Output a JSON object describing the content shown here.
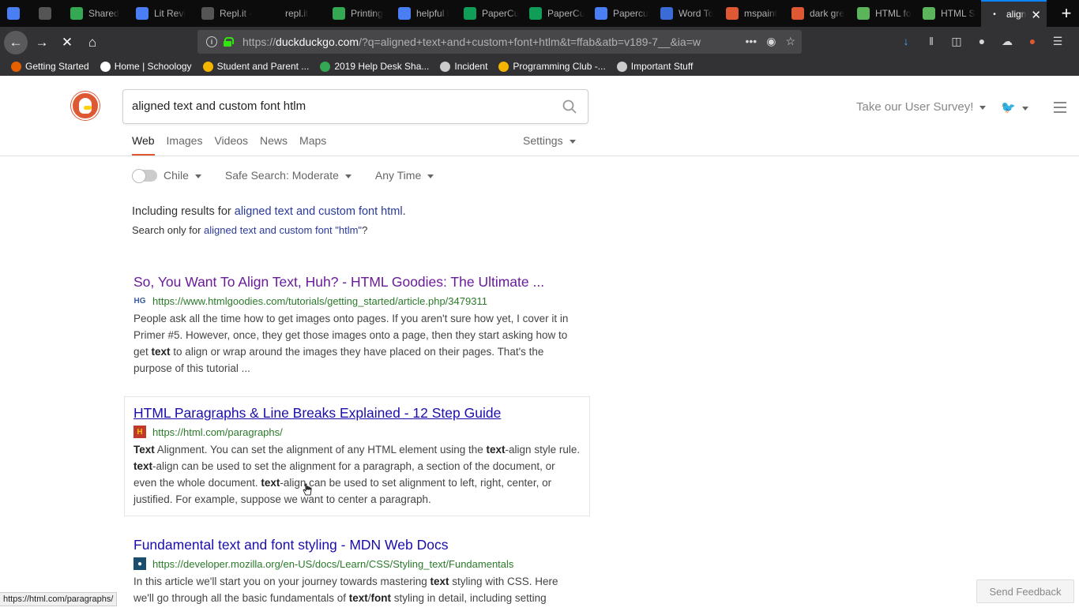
{
  "tabs": [
    {
      "title": "",
      "color": "#4a7ef5",
      "icon": "docs-icon"
    },
    {
      "title": "",
      "color": "#555",
      "icon": "replit-icon"
    },
    {
      "title": "Shared",
      "color": "#34a853",
      "icon": "drive-icon"
    },
    {
      "title": "Lit Revi",
      "color": "#4a7ef5",
      "icon": "docs-icon"
    },
    {
      "title": "Repl.it -",
      "color": "#555",
      "icon": "replit-icon"
    },
    {
      "title": "repl.it",
      "color": "transparent",
      "icon": "none"
    },
    {
      "title": "Printing",
      "color": "#34a853",
      "icon": "drive-icon"
    },
    {
      "title": "helpful l",
      "color": "#4a7ef5",
      "icon": "docs-icon"
    },
    {
      "title": "PaperCu",
      "color": "#0f9d58",
      "icon": "sheets-icon"
    },
    {
      "title": "PaperCu",
      "color": "#0f9d58",
      "icon": "classroom-icon"
    },
    {
      "title": "Papercu",
      "color": "#4a7ef5",
      "icon": "docs-icon"
    },
    {
      "title": "Word To",
      "color": "#3b6bd6",
      "icon": "converter-icon"
    },
    {
      "title": "mspaint",
      "color": "#de5833",
      "icon": "duckduckgo-icon"
    },
    {
      "title": "dark gre",
      "color": "#de5833",
      "icon": "duckduckgo-icon"
    },
    {
      "title": "HTML fo",
      "color": "#5bb55b",
      "icon": "chart-icon"
    },
    {
      "title": "HTML S",
      "color": "#5bb55b",
      "icon": "chart-icon"
    },
    {
      "title": "align",
      "color": "transparent",
      "icon": "loading-icon",
      "active": true
    }
  ],
  "url": {
    "prefix": "https://",
    "host": "duckduckgo.com",
    "path": "/?q=aligned+text+and+custom+font+htlm&t=ffab&atb=v189-7__&ia=w"
  },
  "bookmarks": [
    {
      "label": "Getting Started",
      "color": "#e66000"
    },
    {
      "label": "Home | Schoology",
      "color": "#ffffff"
    },
    {
      "label": "Student and Parent ...",
      "color": "#f5b400"
    },
    {
      "label": "2019 Help Desk Sha...",
      "color": "#34a853"
    },
    {
      "label": "Incident",
      "color": "#cccccc"
    },
    {
      "label": "Programming Club -...",
      "color": "#f5b400"
    },
    {
      "label": "Important Stuff",
      "color": "#cccccc"
    }
  ],
  "search": {
    "query": "aligned text and custom font htlm"
  },
  "header": {
    "survey": "Take our User Survey!"
  },
  "nav": {
    "web": "Web",
    "images": "Images",
    "videos": "Videos",
    "news": "News",
    "maps": "Maps",
    "settings": "Settings"
  },
  "filters": {
    "region": "Chile",
    "safe": "Safe Search: Moderate",
    "time": "Any Time"
  },
  "spelling": {
    "including_prefix": "Including results for ",
    "including_link": "aligned text and custom font html",
    "including_suffix": ".",
    "only_prefix": "Search only for ",
    "only_link": "aligned text and custom font \"htlm\"",
    "only_suffix": "?"
  },
  "results": [
    {
      "title": "So, You Want To Align Text, Huh? - HTML Goodies: The Ultimate ...",
      "url": "https://www.htmlgoodies.com/tutorials/getting_started/article.php/3479311",
      "favicon": "HG",
      "snippet_html": "People ask all the time how to get images onto pages. If you aren't sure how yet, I cover it in Primer #5. However, once, they get those images onto a page, then they start asking how to get <b>text</b> to align or wrap around the images they have placed on their pages. That's the purpose of this tutorial ..."
    },
    {
      "title": "HTML Paragraphs & Line Breaks Explained - 12 Step Guide",
      "url": "https://html.com/paragraphs/",
      "favicon": "H",
      "snippet_html": "<b>Text</b> Alignment. You can set the alignment of any HTML element using the <b>text</b>-align style rule. <b>text</b>-align can be used to set the alignment for a paragraph, a section of the document, or even the whole document. <b>text</b>-align can be used to set alignment to left, right, center, or justified. For example, suppose we want to center a paragraph."
    },
    {
      "title": "Fundamental text and font styling - MDN Web Docs",
      "url": "https://developer.mozilla.org/en-US/docs/Learn/CSS/Styling_text/Fundamentals",
      "favicon": "",
      "snippet_html": "In this article we'll start you on your journey towards mastering <b>text</b> styling with CSS. Here we'll go through all the basic fundamentals of <b>text</b>/<b>font</b> styling in detail, including setting"
    }
  ],
  "status_url": "https://html.com/paragraphs/",
  "feedback": "Send Feedback"
}
